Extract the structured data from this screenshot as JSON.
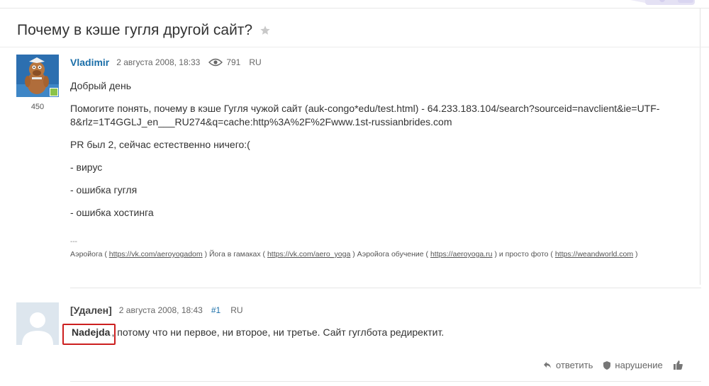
{
  "thread": {
    "title": "Почему в кэше гугля другой сайт?"
  },
  "post": {
    "author": "Vladimir",
    "date": "2 августа 2008, 18:33",
    "views": "791",
    "lang": "RU",
    "rating": "450",
    "paragraphs": [
      "Добрый день",
      "Помогите понять, почему в кэше Гугля чужой сайт (auk-congo*edu/test.html) - 64.233.183.104/search?sourceid=navclient&ie=UTF-8&rlz=1T4GGLJ_en___RU274&q=cache:http%3A%2F%2Fwww.1st-russianbrides.com",
      "PR был 2, сейчас естественно ничего:(",
      "- вирус",
      "- ошибка гугля",
      "- ошибка хостинга"
    ],
    "signature": {
      "dash": "---",
      "t1": "Аэройога ( ",
      "l1": "https://vk.com/aeroyogadom",
      "t2": " ) Йога в гамаках ( ",
      "l2": "https://vk.com/aero_yoga",
      "t3": " ) Аэройога обучение ( ",
      "l3": "https://aeroyoga.ru",
      "t4": " ) и просто фото ( ",
      "l4": "https://weandworld.com",
      "t5": " )"
    }
  },
  "reply": {
    "author": "[Удален]",
    "date": "2 августа 2008, 18:43",
    "number": "#1",
    "lang": "RU",
    "mention": "Nadejda",
    "text": ", потому что ни первое, ни второе, ни третье. Сайт гуглбота редиректит.",
    "actions": {
      "reply": "ответить",
      "report": "нарушение"
    }
  },
  "colors": {
    "accent": "#1a6ea8",
    "highlight": "#cc1f1f",
    "online": "#8bc34a"
  }
}
